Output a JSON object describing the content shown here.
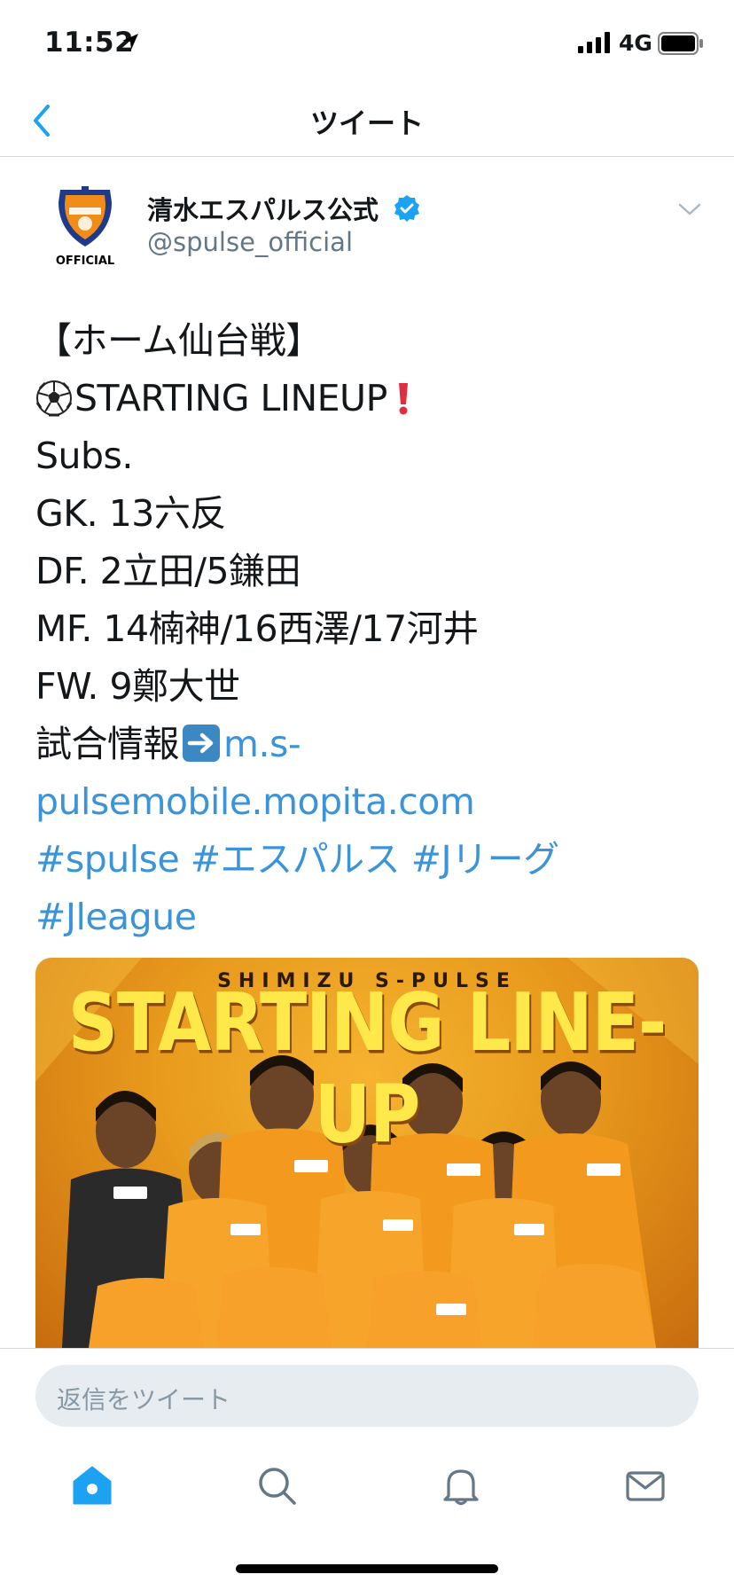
{
  "status_bar": {
    "time": "11:52",
    "network": "4G"
  },
  "nav": {
    "title": "ツイート"
  },
  "tweet": {
    "display_name": "清水エスパルス公式",
    "handle": "@spulse_official",
    "avatar_text": "OFFICIAL",
    "lines": {
      "l1": "【ホーム仙台戦】",
      "l2": "STARTING LINEUP",
      "l3": "Subs.",
      "l4": "GK. 13六反",
      "l5": "DF. 2立田/5鎌田",
      "l6": "MF. 14楠神/16西澤/17河井",
      "l7": "FW. 9鄭大世",
      "l8_text": "試合情報",
      "l8_link": "m.s-",
      "l9_link": "pulsemobile.mopita.com",
      "hashtags": [
        "#spulse",
        "#エスパルス",
        "#Jリーグ",
        "#Jleague"
      ]
    },
    "media": {
      "subtitle": "SHIMIZU S-PULSE",
      "title": "STARTING LINE-UP"
    }
  },
  "reply": {
    "placeholder": "返信をツイート"
  },
  "tabbar": {
    "items": [
      "home-icon",
      "search-icon",
      "notifications-icon",
      "messages-icon"
    ],
    "active_color": "#1da1f2",
    "inactive_color": "#657786"
  },
  "colors": {
    "link": "#3b94d9",
    "accent": "#1da1f2"
  }
}
